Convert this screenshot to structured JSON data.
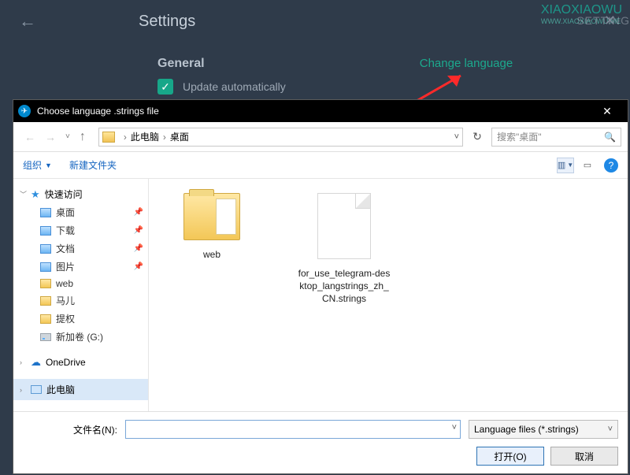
{
  "settings": {
    "title": "Settings",
    "general_label": "General",
    "update_label": "Update automatically",
    "change_language": "Change language",
    "right_label": "SETTING"
  },
  "watermark": {
    "name": "XIAOXIAOWU",
    "url": "WWW.XIAOXIAOWU.ME"
  },
  "dialog": {
    "title": "Choose language .strings file",
    "path": {
      "root": "此电脑",
      "folder": "桌面"
    },
    "search_placeholder": "搜索\"桌面\"",
    "toolbar": {
      "organize": "组织",
      "new_folder": "新建文件夹"
    },
    "sidebar": {
      "quick_access": "快速访问",
      "pinned": [
        {
          "label": "桌面",
          "icon": "folder-blue"
        },
        {
          "label": "下载",
          "icon": "folder-blue"
        },
        {
          "label": "文档",
          "icon": "folder-blue"
        },
        {
          "label": "图片",
          "icon": "folder-blue"
        },
        {
          "label": "web",
          "icon": "folder"
        },
        {
          "label": "马儿",
          "icon": "folder"
        },
        {
          "label": "提权",
          "icon": "folder"
        },
        {
          "label": "新加卷 (G:)",
          "icon": "drive"
        }
      ],
      "onedrive": "OneDrive",
      "this_pc": "此电脑"
    },
    "items": [
      {
        "type": "folder",
        "label": "web"
      },
      {
        "type": "file",
        "label": "for_use_telegram-desktop_langstrings_zh_CN.strings"
      }
    ],
    "footer": {
      "filename_label": "文件名(N):",
      "filename_value": "",
      "filetype": "Language files (*.strings)",
      "open": "打开(O)",
      "cancel": "取消"
    }
  }
}
